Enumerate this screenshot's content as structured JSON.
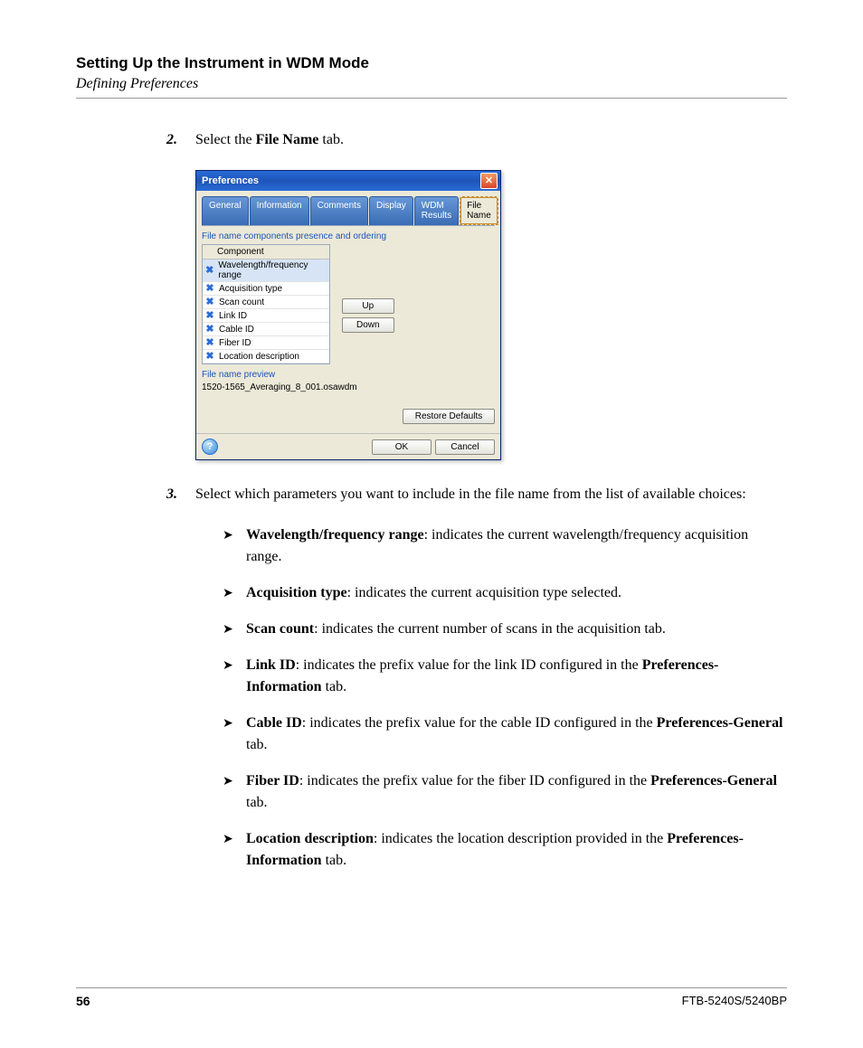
{
  "header": {
    "title": "Setting Up the Instrument in WDM Mode",
    "subtitle": "Defining Preferences"
  },
  "step2": {
    "num": "2.",
    "pre": "Select the ",
    "bold": "File Name",
    "post": " tab."
  },
  "dialog": {
    "title": "Preferences",
    "tabs": [
      "General",
      "Information",
      "Comments",
      "Display",
      "WDM Results",
      "File Name"
    ],
    "section_label": "File name components presence and ordering",
    "component_header": "Component",
    "components": [
      "Wavelength/frequency range",
      "Acquisition type",
      "Scan count",
      "Link ID",
      "Cable ID",
      "Fiber ID",
      "Location description"
    ],
    "btn_up": "Up",
    "btn_down": "Down",
    "preview_label": "File name preview",
    "preview_value": "1520-1565_Averaging_8_001.osawdm",
    "btn_restore": "Restore Defaults",
    "btn_ok": "OK",
    "btn_cancel": "Cancel"
  },
  "step3": {
    "num": "3.",
    "text": "Select which parameters you want to include in the file name from the list of available choices:"
  },
  "bullets": [
    {
      "bold": "Wavelength/frequency range",
      "rest": ": indicates the current wavelength/frequency acquisition range."
    },
    {
      "bold": "Acquisition type",
      "rest": ": indicates the current acquisition type selected."
    },
    {
      "bold": "Scan count",
      "rest": ": indicates the current number of scans in the acquisition tab."
    },
    {
      "bold": "Link ID",
      "rest_pre": ": indicates the prefix value for the link ID configured in the ",
      "rest_bold": "Preferences-Information",
      "rest_post": " tab."
    },
    {
      "bold": "Cable ID",
      "rest_pre": ": indicates the prefix value for the cable ID configured in the ",
      "rest_bold": "Preferences-General",
      "rest_post": " tab."
    },
    {
      "bold": "Fiber ID",
      "rest_pre": ": indicates the prefix value for the fiber ID configured in the ",
      "rest_bold": "Preferences-General",
      "rest_post": " tab."
    },
    {
      "bold": "Location description",
      "rest_pre": ": indicates the location description provided in the ",
      "rest_bold": "Preferences-Information",
      "rest_post": " tab."
    }
  ],
  "footer": {
    "page": "56",
    "model": "FTB-5240S/5240BP"
  }
}
